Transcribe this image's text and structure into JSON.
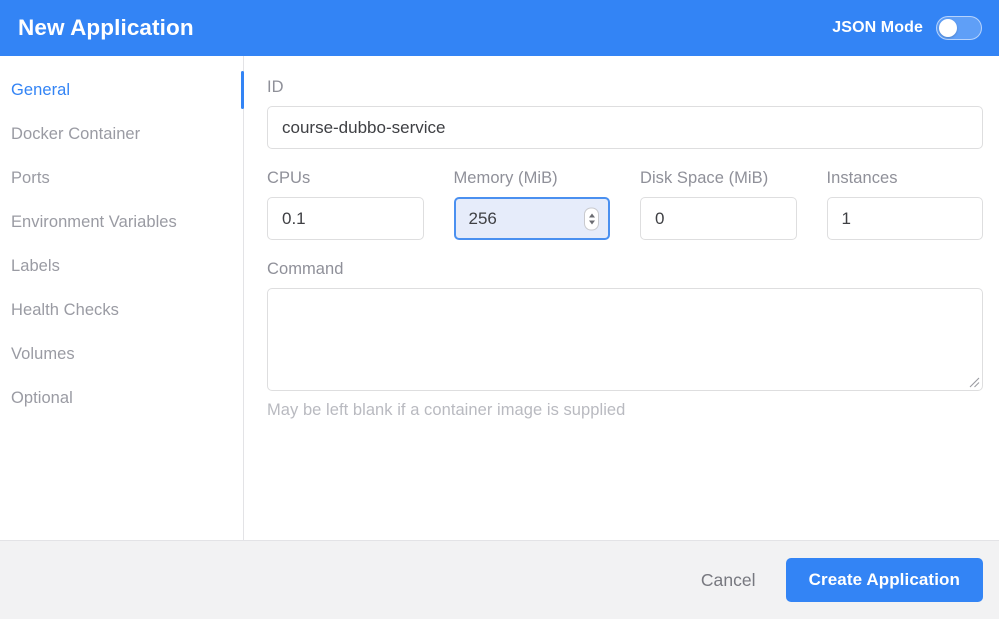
{
  "header": {
    "title": "New Application",
    "json_mode_label": "JSON Mode",
    "json_mode_on": false,
    "accent_color": "#3384f5",
    "title_color": "#ffffff"
  },
  "sidebar": {
    "active_index": 0,
    "active_color": "#3384f5",
    "inactive_color": "#9a9ba3",
    "items": [
      {
        "label": "General"
      },
      {
        "label": "Docker Container"
      },
      {
        "label": "Ports"
      },
      {
        "label": "Environment Variables"
      },
      {
        "label": "Labels"
      },
      {
        "label": "Health Checks"
      },
      {
        "label": "Volumes"
      },
      {
        "label": "Optional"
      }
    ]
  },
  "form": {
    "id_field": {
      "label": "ID",
      "value": "course-dubbo-service",
      "placeholder": ""
    },
    "cpus_field": {
      "label": "CPUs",
      "value": "0.1",
      "placeholder": ""
    },
    "memory_field": {
      "label": "Memory (MiB)",
      "value": "256",
      "placeholder": "",
      "focused": true,
      "focus_border_color": "#4a90f0",
      "focus_background_color": "#e6ecfa"
    },
    "disk_field": {
      "label": "Disk Space (MiB)",
      "value": "0",
      "placeholder": ""
    },
    "instances_field": {
      "label": "Instances",
      "value": "1",
      "placeholder": ""
    },
    "command_field": {
      "label": "Command",
      "value": "",
      "placeholder": "",
      "helper_text": "May be left blank if a container image is supplied"
    }
  },
  "footer": {
    "cancel_label": "Cancel",
    "submit_label": "Create Application",
    "submit_color": "#3384f5",
    "background_color": "#f2f2f3"
  },
  "icons": {
    "toggle_knob": "toggle-knob",
    "spinner_up": "chevron-up-icon",
    "spinner_down": "chevron-down-icon",
    "resize_grip": "resize-grip-icon"
  }
}
